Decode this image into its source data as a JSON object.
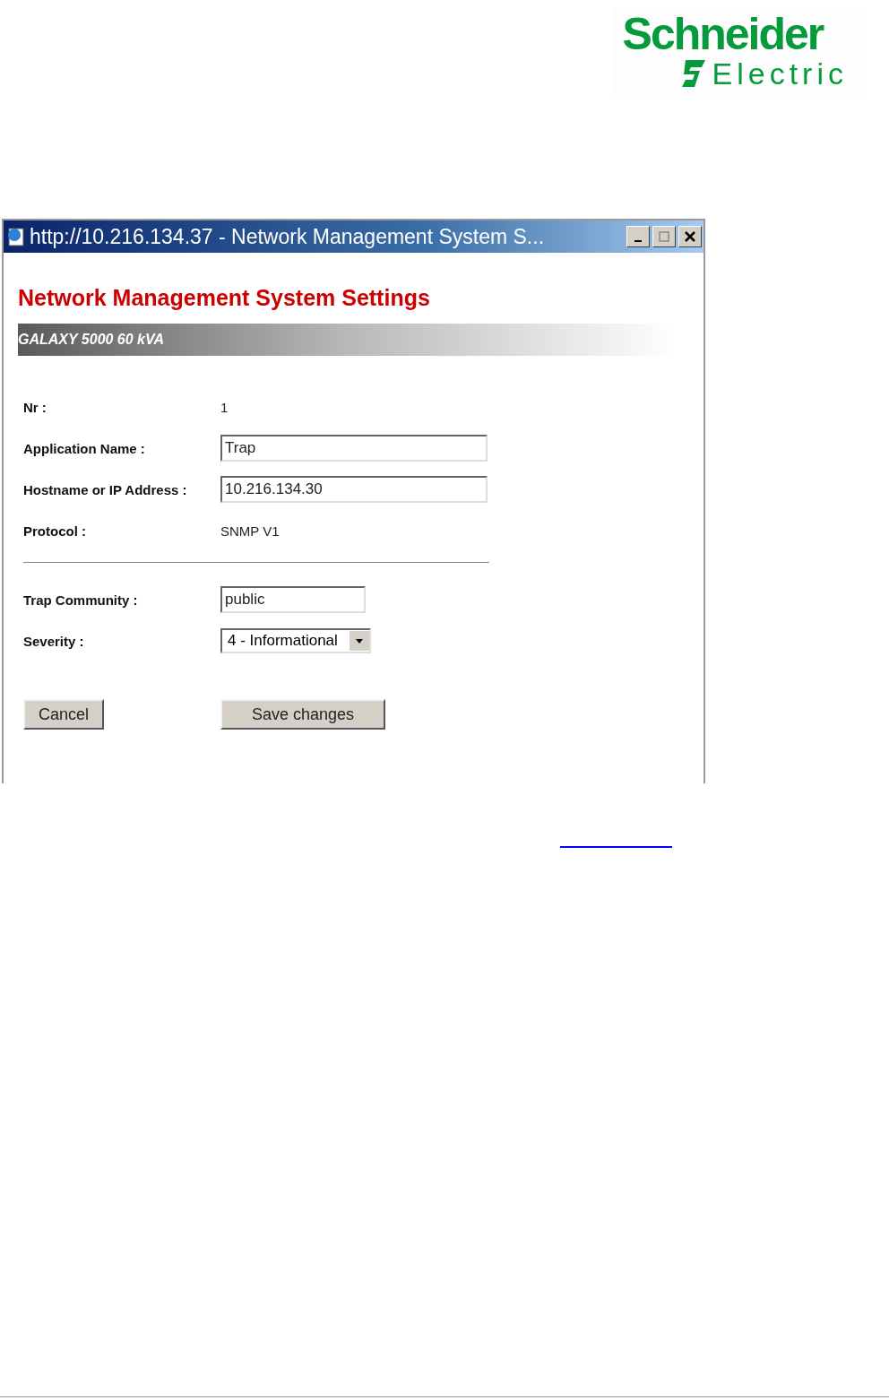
{
  "logo": {
    "name": "Schneider",
    "subtitle": "Electric"
  },
  "window": {
    "title": "http://10.216.134.37 - Network Management System S..."
  },
  "page": {
    "heading": "Network Management System Settings",
    "device": "GALAXY 5000 60 kVA"
  },
  "sections": [
    [
      {
        "label": "Nr :",
        "kind": "text",
        "value": "1"
      },
      {
        "label": "Application Name :",
        "kind": "input",
        "value": "Trap"
      },
      {
        "label": "Hostname or IP Address :",
        "kind": "input",
        "value": "10.216.134.30"
      },
      {
        "label": "Protocol :",
        "kind": "text",
        "value": "SNMP V1"
      }
    ],
    [
      {
        "label": "Trap Community :",
        "kind": "short-input",
        "value": "public"
      },
      {
        "label": "Severity :",
        "kind": "select",
        "value": "4 - Informational"
      }
    ]
  ],
  "buttons": [
    "Cancel",
    "Save changes"
  ]
}
